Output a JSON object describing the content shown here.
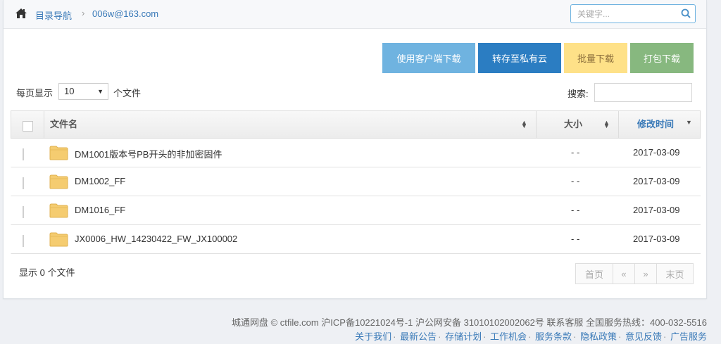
{
  "breadcrumb": {
    "home_label": "目录导航",
    "separator": "›",
    "current": "006w@163.com"
  },
  "search": {
    "placeholder": "关键字..."
  },
  "toolbar": {
    "client_download": "使用客户端下载",
    "save_private": "转存至私有云",
    "batch_download": "批量下载",
    "pack_download": "打包下载"
  },
  "controls": {
    "per_page_label": "每页显示",
    "per_page_value": "10",
    "per_page_unit": "个文件",
    "filter_label": "搜索:"
  },
  "table": {
    "headers": {
      "name": "文件名",
      "size": "大小",
      "modified": "修改时间"
    },
    "rows": [
      {
        "name": "DM1001版本号PB开头的非加密固件",
        "size": "- -",
        "modified": "2017-03-09"
      },
      {
        "name": "DM1002_FF",
        "size": "- -",
        "modified": "2017-03-09"
      },
      {
        "name": "DM1016_FF",
        "size": "- -",
        "modified": "2017-03-09"
      },
      {
        "name": "JX0006_HW_14230422_FW_JX100002",
        "size": "- -",
        "modified": "2017-03-09"
      }
    ]
  },
  "summary": "显示 0 个文件",
  "pager": {
    "first": "首页",
    "prev": "«",
    "next": "»",
    "last": "末页"
  },
  "footer": {
    "copyright": "城通网盘 © ctfile.com  沪ICP备10221024号-1   沪公网安备 31010102002062号  联系客服   全国服务热线：400-032-5516",
    "links": [
      "关于我们",
      "最新公告",
      "存储计划",
      "工作机会",
      "服务条款",
      "隐私政策",
      "意见反馈",
      "广告服务"
    ]
  },
  "colors": {
    "link": "#3a7ab8",
    "btn_client": "#6fb3e0",
    "btn_private": "#2b7dc2",
    "btn_batch": "#fee188",
    "btn_pack": "#87b87f",
    "folder": "#f5cc70"
  },
  "icons": [
    "home-icon",
    "search-icon",
    "folder-icon",
    "sort-icon",
    "sort-desc-icon",
    "chevron-down-icon"
  ]
}
